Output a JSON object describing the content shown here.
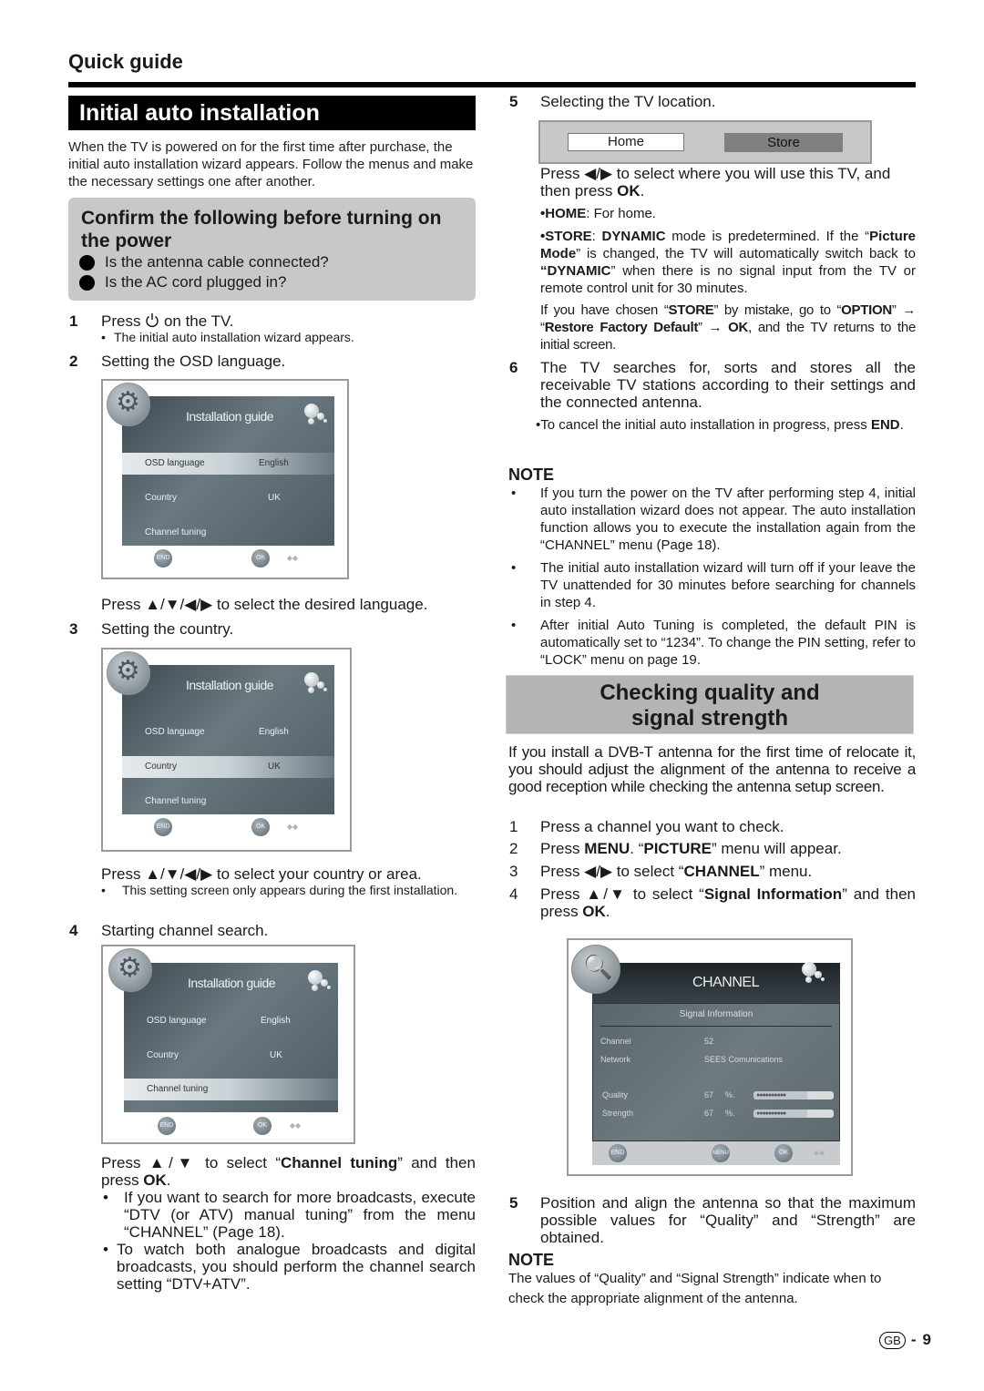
{
  "header": {
    "section": "Quick guide",
    "title": "Initial auto installation"
  },
  "intro": "When the TV is powered on for the first time after purchase, the initial auto installation wizard appears. Follow the menus and make the necessary settings one after another.",
  "confirm": {
    "title": "Confirm the following before turning on the power",
    "items": [
      "Is the antenna cable connected?",
      "Is the AC cord plugged in?"
    ]
  },
  "left_steps": {
    "s1": {
      "num": "1",
      "pre": "Press",
      "icon": "power-icon",
      "post": "on the TV.",
      "note": "The initial auto installation wizard appears."
    },
    "s2": {
      "num": "2",
      "text": "Setting the OSD language.",
      "instr": "Press ▲/▼/◀/▶ to select the desired language."
    },
    "s3": {
      "num": "3",
      "text": "Setting the country.",
      "instr": "Press ▲/▼/◀/▶ to select your country or area.",
      "note": "This setting screen only appears during the first installation."
    },
    "s4": {
      "num": "4",
      "text": "Starting channel search.",
      "instr_pre": "Press ▲/▼ to select “",
      "instr_bold": "Channel tuning",
      "instr_mid": "” and then press ",
      "instr_ok": "OK",
      "instr_end": ".",
      "notes": [
        "If you want to search for more broadcasts, execute “DTV (or ATV) manual tuning” from the menu “CHANNEL” (Page 18).",
        "To watch both analogue broadcasts and digital broadcasts, you should perform the channel search setting “DTV+ATV”."
      ]
    }
  },
  "osd": {
    "title": "Installation guide",
    "rows": [
      {
        "label": "OSD language",
        "value": "English"
      },
      {
        "label": "Country",
        "value": "UK"
      },
      {
        "label": "Channel tuning",
        "value": ""
      }
    ],
    "btn_end": "END",
    "btn_ok": "OK",
    "highlighted": [
      0,
      1,
      2
    ]
  },
  "right_steps": {
    "s5": {
      "num": "5",
      "text": "Selecting the TV location.",
      "options": {
        "home": "Home",
        "store": "Store",
        "selected": "Store"
      },
      "instr_pre": "Press ◀/▶ to select where you will use this TV, and then press ",
      "instr_ok": "OK",
      "home_label": "•HOME",
      "home_text": ": For home.",
      "store_label": "•STORE",
      "store_colon": ": ",
      "store_dynamic": "DYNAMIC",
      "store_t1": " mode is predetermined. If the “",
      "store_pm": "Picture Mode",
      "store_t2": "” is changed, the TV will automatically switch back to ",
      "store_dyn2": "“DYNAMIC",
      "store_t3": "” when there is no signal input from the TV or remote control unit for 30 minutes.",
      "mistake_t1": "If you have chosen “",
      "mistake_store": "STORE",
      "mistake_t2": "” by mistake, go to “",
      "mistake_option": "OPTION",
      "mistake_t3": "” → “",
      "mistake_restore": "Restore Factory Default",
      "mistake_t4": "” → ",
      "mistake_ok": "OK",
      "mistake_t5": ", and the TV returns to the initial screen."
    },
    "s6": {
      "num": "6",
      "text": "The TV searches for, sorts and stores all the receivable TV stations according to their settings and the connected antenna.",
      "cancel_pre": "•To cancel the initial auto installation in progress, press ",
      "cancel_end": "END",
      "cancel_dot": "."
    }
  },
  "note1": {
    "head": "NOTE",
    "items": [
      "If you turn the power on the TV after performing step 4, initial auto installation wizard does not appear. The auto installation function allows you to execute the installation again from the “CHANNEL” menu (Page 18).",
      "The initial auto installation wizard will turn off if your leave the TV unattended for 30 minutes before searching for channels in step 4.",
      "After initial Auto Tuning is completed, the default PIN is automatically set to “1234”. To change the PIN setting, refer to “LOCK” menu on page 19."
    ]
  },
  "checking": {
    "title_l1": "Checking quality and",
    "title_l2": "signal strength",
    "intro": "If you install a DVB-T antenna for the first time of relocate it, you should adjust the alignment of the antenna to receive a good reception while checking the antenna setup screen.",
    "steps": {
      "c1": {
        "num": "1",
        "text": "Press a channel you want to check."
      },
      "c2": {
        "num": "2",
        "t1": "Press ",
        "b1": "MENU",
        "t2": ". “",
        "b2": "PICTURE",
        "t3": "” menu will appear."
      },
      "c3": {
        "num": "3",
        "t1": "Press ◀/▶ to select “",
        "b1": "CHANNEL",
        "t2": "” menu."
      },
      "c4": {
        "num": "4",
        "t1": "Press ▲/▼ to select “",
        "b1": "Signal Information",
        "t2": "” and then press ",
        "b2": "OK",
        "t3": "."
      },
      "c5": {
        "num": "5",
        "text": "Position and align the antenna so that the maximum possible values for “Quality” and “Strength” are obtained."
      }
    },
    "note_head": "NOTE",
    "note_text": "The values of “Quality” and “Signal Strength” indicate when to check the appropriate alignment of the antenna."
  },
  "channel_screen": {
    "title": "CHANNEL",
    "subtitle": "Signal Information",
    "channel_label": "Channel",
    "channel_value": "52",
    "network_label": "Network",
    "network_value": "SEES Comunications",
    "quality_label": "Quality",
    "quality_value": "67",
    "strength_label": "Strength",
    "strength_value": "67",
    "unit": "%.",
    "bar_glyphs": "●●●●●●●●●●",
    "btn_end": "END",
    "btn_menu": "MENU",
    "btn_ok": "OK"
  },
  "footer": {
    "region": "GB",
    "sep": "-",
    "page": "9"
  }
}
